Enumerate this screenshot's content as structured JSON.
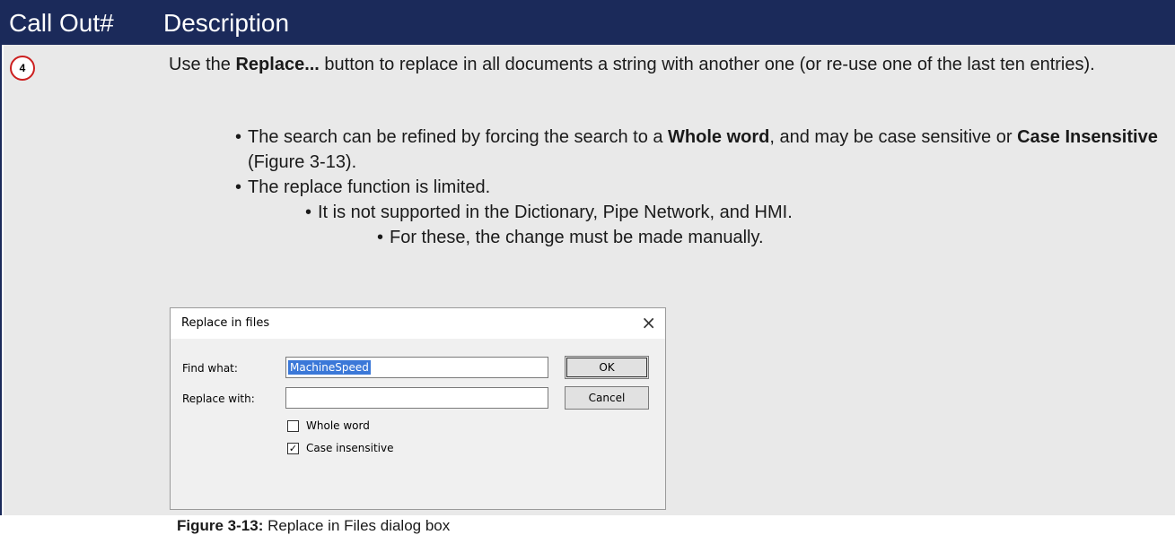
{
  "header": {
    "col1": "Call Out#",
    "col2": "Description"
  },
  "callout_number": "4",
  "intro": {
    "pre": "Use the ",
    "bold": "Replace...",
    "post": " button to replace in all documents a string with another one (or re-use one of the last ten entries)."
  },
  "bullets": {
    "b1": {
      "pre": "The search can be refined by forcing the search to a ",
      "bold1": "Whole word",
      "mid": ", and may be case sensitive or ",
      "bold2": "Case Insensitive",
      "post": " (Figure 3-13)."
    },
    "b2": "The replace function is limited.",
    "b3": "It is not supported in the Dictionary, Pipe Network, and HMI.",
    "b4": "For these, the change must be made manually."
  },
  "dialog": {
    "title": "Replace in files",
    "close": "×",
    "find_label": "Find what:",
    "find_value": "MachineSpeed",
    "replace_label": "Replace with:",
    "replace_value": "",
    "ok": "OK",
    "cancel": "Cancel",
    "whole_word": {
      "label": "Whole word",
      "checked": false
    },
    "case_insensitive": {
      "label": "Case insensitive",
      "checked": true
    }
  },
  "caption": {
    "bold": "Figure 3-13:",
    "text": " Replace in Files dialog box"
  }
}
